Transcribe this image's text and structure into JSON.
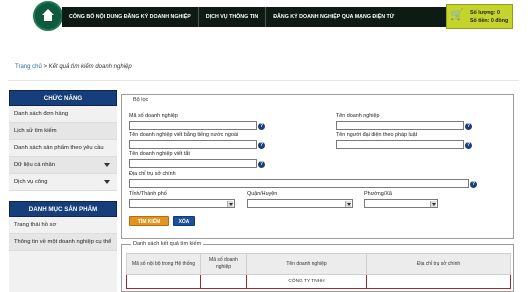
{
  "nav": {
    "items": [
      "CÔNG BỐ NỘI DUNG ĐĂNG KÝ DOANH NGHIỆP",
      "DỊCH VỤ THÔNG TIN",
      "ĐĂNG KÝ DOANH NGHIỆP QUA MẠNG ĐIỆN TỬ"
    ]
  },
  "cart": {
    "count_line": "Số lượng: 0",
    "total_line": "Số tiền: 0 đồng",
    "icon": "cart-icon"
  },
  "breadcrumb": {
    "home": "Trang chủ",
    "separator": " > ",
    "current": "Kết quả tìm kiếm doanh nghiệp"
  },
  "sidebar": {
    "functions_header": "CHỨC NĂNG",
    "functions": [
      {
        "label": "Danh sách đơn hàng",
        "dropdown": false
      },
      {
        "label": "Lịch sử tìm kiếm",
        "dropdown": false
      },
      {
        "label": "Danh sách sản phẩm theo yêu cầu",
        "dropdown": false
      },
      {
        "label": "Dữ liệu cá nhân",
        "dropdown": true
      },
      {
        "label": "Dịch vụ công",
        "dropdown": true
      }
    ],
    "products_header": "DANH MỤC SẢN PHẨM",
    "products": [
      {
        "label": "Trang thái hồ sơ"
      },
      {
        "label": "Thông tin về một doanh nghiệp cụ thể"
      }
    ]
  },
  "filter": {
    "legend": "Bộ lọc",
    "enterprise_code_label": "Mã số doanh nghiệp",
    "enterprise_name_label": "Tên doanh nghiệp",
    "foreign_name_label": "Tên doanh nghiệp viết bằng tiếng nước ngoài",
    "legal_rep_label": "Tên người đại diện theo pháp luật",
    "short_name_label": "Tên doanh nghiệp viết tắt",
    "address_label": "Địa chỉ trụ sở chính",
    "province_label": "Tỉnh/Thành phố",
    "district_label": "Quận/Huyện",
    "ward_label": "Phường/Xã",
    "enterprise_code_value": "",
    "enterprise_name_value": "",
    "foreign_name_value": "",
    "legal_rep_value": "",
    "short_name_value": "",
    "address_value": "",
    "province_value": "",
    "district_value": "",
    "ward_value": "",
    "search_button": "TÌM KIẾM",
    "clear_button": "XÓA"
  },
  "results": {
    "legend": "Danh sách kết quả tìm kiếm",
    "columns": [
      "Mã số nội bộ trong Hệ thống",
      "Mã số doanh nghiệp",
      "Tên doanh nghiệp",
      "Địa chỉ trụ sở chính"
    ],
    "rows": [
      {
        "cells": [
          "",
          "",
          "CÔNG TY TNHH",
          ""
        ]
      }
    ]
  }
}
